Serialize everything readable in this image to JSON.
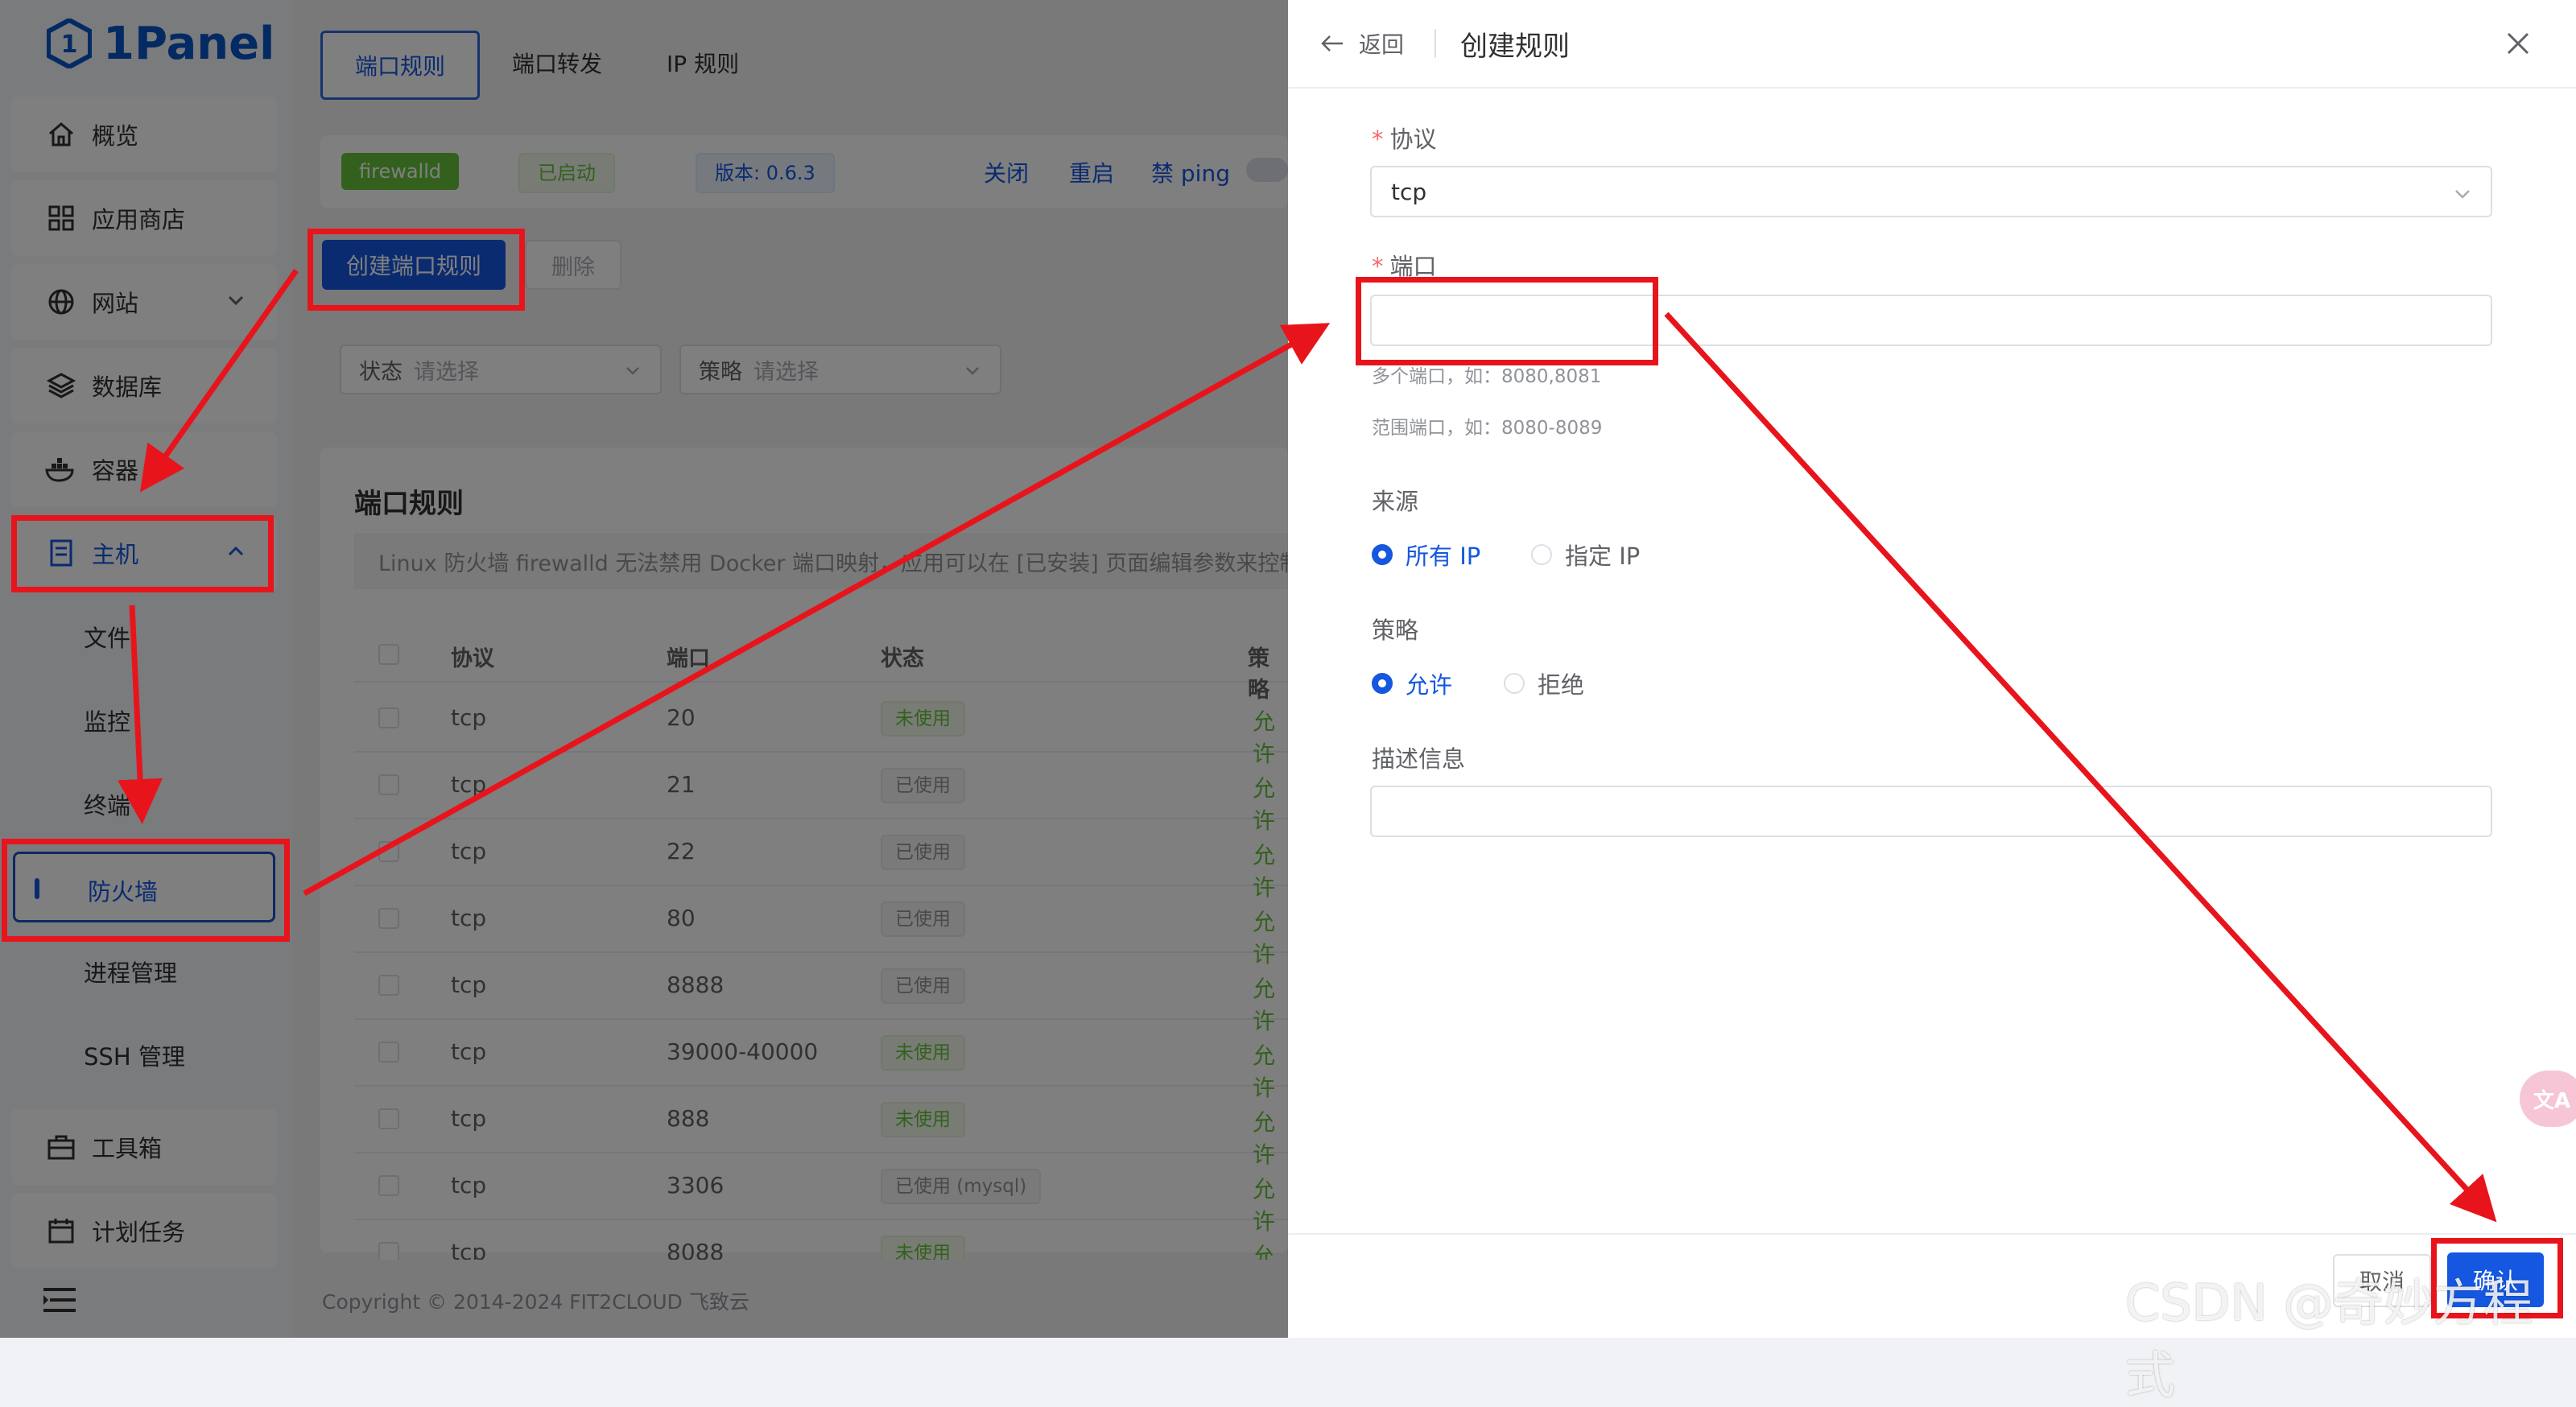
{
  "app": {
    "logo_text": "1Panel"
  },
  "sidebar": {
    "items": [
      {
        "label": "概览",
        "icon": "home-icon"
      },
      {
        "label": "应用商店",
        "icon": "grid-icon"
      },
      {
        "label": "网站",
        "icon": "globe-icon"
      },
      {
        "label": "数据库",
        "icon": "layers-icon"
      },
      {
        "label": "容器",
        "icon": "docker-icon"
      },
      {
        "label": "主机",
        "icon": "server-icon"
      },
      {
        "label": "工具箱",
        "icon": "toolbox-icon"
      },
      {
        "label": "计划任务",
        "icon": "calendar-icon"
      }
    ],
    "sub_items": [
      "文件",
      "监控",
      "终端",
      "防火墙",
      "进程管理",
      "SSH 管理"
    ],
    "active_sub": "防火墙"
  },
  "main": {
    "tabs": [
      "端口规则",
      "端口转发",
      "IP 规则"
    ],
    "status": {
      "name": "firewalld",
      "state": "已启动",
      "version": "版本: 0.6.3",
      "actions": [
        "关闭",
        "重启",
        "禁 ping"
      ]
    },
    "toolbar": {
      "create_label": "创建端口规则",
      "delete_label": "删除"
    },
    "filters": [
      {
        "label": "状态",
        "placeholder": "请选择"
      },
      {
        "label": "策略",
        "placeholder": "请选择"
      }
    ],
    "card_title": "端口规则",
    "notice": "Linux 防火墙 firewalld 无法禁用 Docker 端口映射，应用可以在 [已安装] 页面编辑参数来控制",
    "columns": [
      "协议",
      "端口",
      "状态",
      "策略"
    ],
    "rows": [
      {
        "protocol": "tcp",
        "port": "20",
        "status": "未使用",
        "strategy": "允许"
      },
      {
        "protocol": "tcp",
        "port": "21",
        "status": "已使用",
        "strategy": "允许"
      },
      {
        "protocol": "tcp",
        "port": "22",
        "status": "已使用",
        "strategy": "允许"
      },
      {
        "protocol": "tcp",
        "port": "80",
        "status": "已使用",
        "strategy": "允许"
      },
      {
        "protocol": "tcp",
        "port": "8888",
        "status": "已使用",
        "strategy": "允许"
      },
      {
        "protocol": "tcp",
        "port": "39000-40000",
        "status": "未使用",
        "strategy": "允许"
      },
      {
        "protocol": "tcp",
        "port": "888",
        "status": "未使用",
        "strategy": "允许"
      },
      {
        "protocol": "tcp",
        "port": "3306",
        "status": "已使用 (mysql)",
        "strategy": "允许"
      },
      {
        "protocol": "tcp",
        "port": "8088",
        "status": "未使用",
        "strategy": "允许"
      }
    ],
    "copyright": "Copyright © 2014-2024 FIT2CLOUD 飞致云"
  },
  "drawer": {
    "back_label": "返回",
    "title": "创建规则",
    "protocol_label": "协议",
    "protocol_value": "tcp",
    "port_label": "端口",
    "port_value": "",
    "port_hint_1": "多个端口，如：8080,8081",
    "port_hint_2": "范围端口，如：8080-8089",
    "source_label": "来源",
    "source_options": [
      "所有 IP",
      "指定 IP"
    ],
    "source_selected": "所有 IP",
    "strategy_label": "策略",
    "strategy_options": [
      "允许",
      "拒绝"
    ],
    "strategy_selected": "允许",
    "desc_label": "描述信息",
    "desc_value": "",
    "cancel_label": "取消",
    "confirm_label": "确认"
  },
  "translate_badge": "文A",
  "watermark": "CSDN @奇妙方程式",
  "colors": {
    "primary": "#1557e0",
    "annotation_red": "#e8141c",
    "success": "#67c23a"
  }
}
